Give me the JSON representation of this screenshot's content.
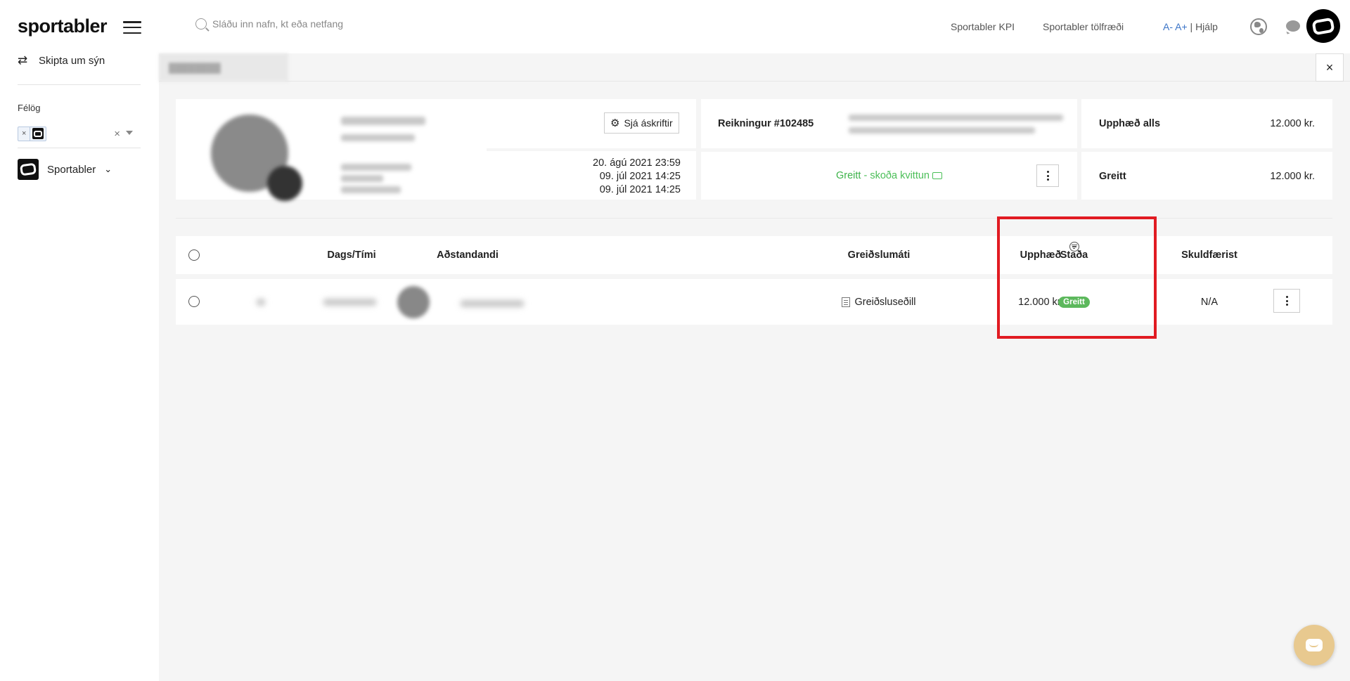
{
  "app": {
    "logo": "sportabler"
  },
  "sidebar": {
    "switch_view": "Skipta um sýn",
    "clubs_label": "Félög",
    "club_chip_remove": "×",
    "clear": "×",
    "org_name": "Sportabler"
  },
  "topbar": {
    "search_placeholder": "Sláðu inn nafn, kt eða netfang",
    "kpi_link": "Sportabler KPI",
    "stats_link": "Sportabler tölfræði",
    "font_decrease": "A-",
    "font_increase": "A+",
    "separator": "|",
    "help": "Hjálp"
  },
  "close_label": "×",
  "profile": {
    "subscriptions_button": "Sjá áskriftir",
    "dates": [
      "20. ágú 2021 23:59",
      "09. júl 2021 14:25",
      "09. júl 2021 14:25"
    ]
  },
  "invoice": {
    "title": "Reikningur #102485",
    "status": "Greitt",
    "receipt_link": " - skoða kvittun"
  },
  "summary": {
    "total_label": "Upphæð alls",
    "total_value": "12.000 kr.",
    "paid_label": "Greitt",
    "paid_value": "12.000 kr."
  },
  "table": {
    "columns": {
      "datetime": "Dags/Tími",
      "guardian": "Aðstandandi",
      "payment_method": "Greiðslumáti",
      "amount": "Upphæð",
      "status": "Staða",
      "debit": "Skuldfærist"
    },
    "rows": [
      {
        "payment_method": "Greiðsluseðill",
        "amount": "12.000 kr.",
        "status": "Greitt",
        "debit": "N/A"
      }
    ]
  },
  "colors": {
    "accent_link": "#3b74c7",
    "paid_green": "#3db34a",
    "badge_green": "#5cb85c",
    "highlight_red": "#e11b22"
  }
}
